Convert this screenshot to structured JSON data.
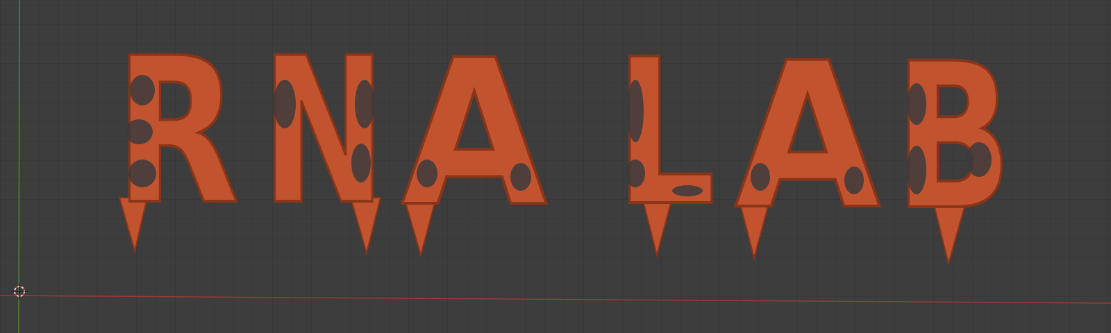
{
  "viewport": {
    "model_text": "RNA LAB",
    "letters": [
      "R",
      "N",
      "A",
      "L",
      "A",
      "B"
    ],
    "colors": {
      "background": "#3d3d3d",
      "grid": "#353535",
      "x_axis": "#9a3a3a",
      "y_axis": "#4f8a2f",
      "model": "#c2532f"
    }
  }
}
